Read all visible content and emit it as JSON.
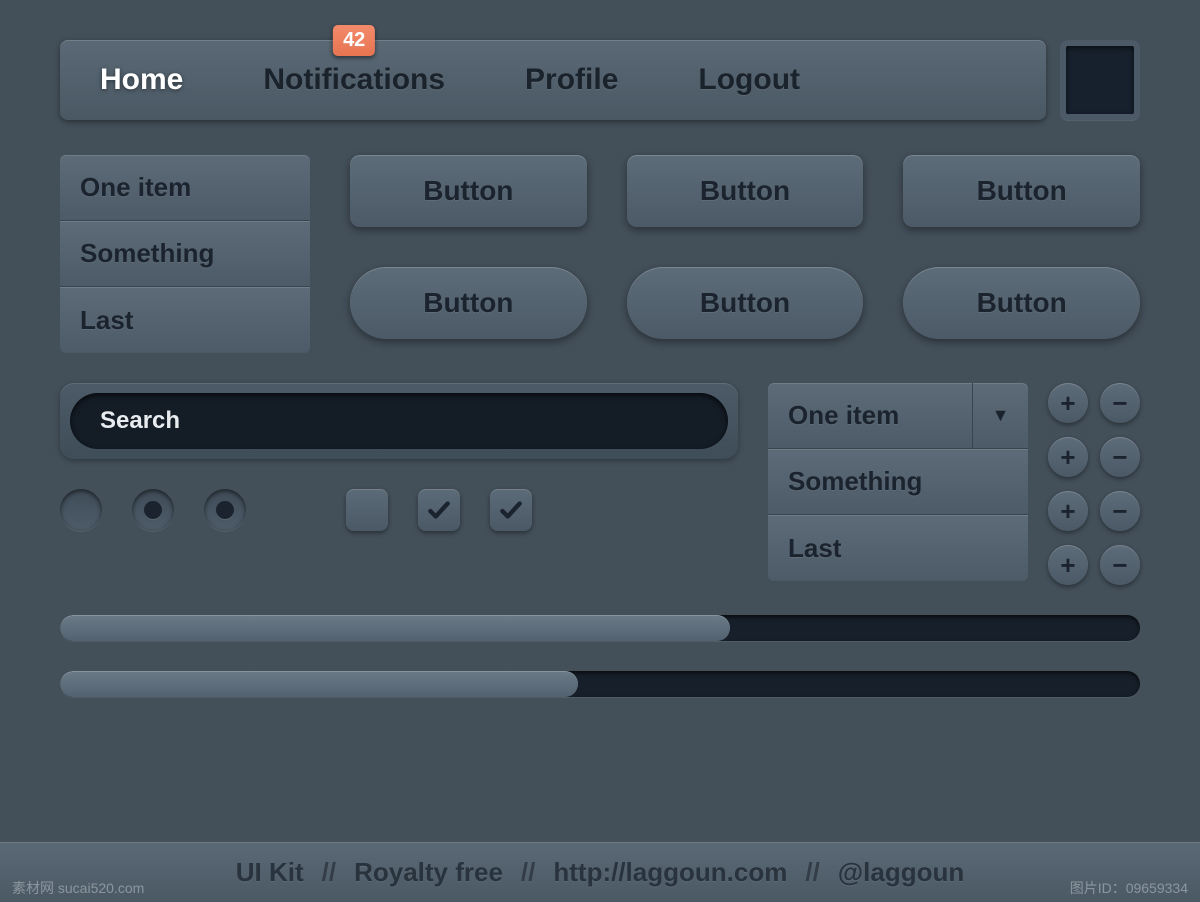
{
  "nav": {
    "items": [
      {
        "label": "Home",
        "active": true
      },
      {
        "label": "Notifications",
        "badge": "42"
      },
      {
        "label": "Profile"
      },
      {
        "label": "Logout"
      }
    ]
  },
  "list": {
    "items": [
      "One item",
      "Something",
      "Last"
    ]
  },
  "buttons": {
    "square": [
      "Button",
      "Button",
      "Button"
    ],
    "pill": [
      "Button",
      "Button",
      "Button"
    ]
  },
  "search": {
    "placeholder": "Search"
  },
  "radios": [
    false,
    true,
    true
  ],
  "checkboxes": [
    false,
    true,
    true
  ],
  "dropdown": {
    "items": [
      "One item",
      "Something",
      "Last"
    ]
  },
  "plusminus": {
    "rows": 4,
    "plus": "+",
    "minus": "−"
  },
  "progress": [
    62,
    48
  ],
  "footer": {
    "parts": [
      "UI Kit",
      "Royalty free",
      "http://laggoun.com",
      "@laggoun"
    ],
    "sep": "//"
  },
  "watermark_left": "素材网 sucai520.com",
  "watermark_right": "图片ID：09659334"
}
